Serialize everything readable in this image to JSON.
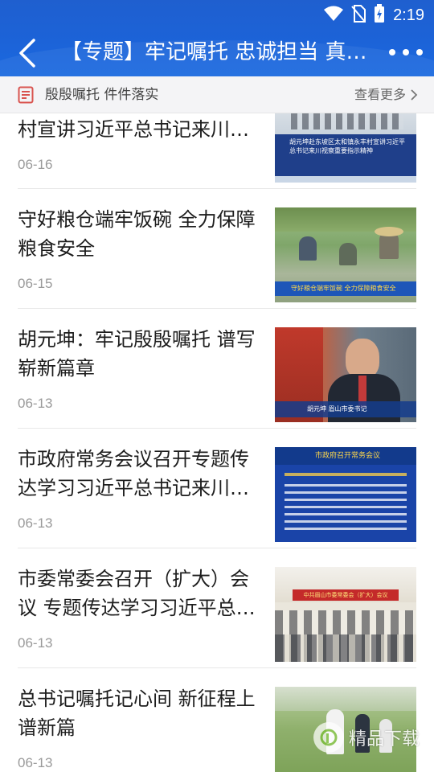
{
  "status_bar": {
    "time": "2:19"
  },
  "header": {
    "title": "【专题】牢记嘱托 忠诚担当 真抓实干"
  },
  "subheader": {
    "title": "殷殷嘱托 件件落实",
    "see_more": "查看更多"
  },
  "articles": [
    {
      "title": "村宣讲习近平总书记来川视察重要指示精神",
      "date": "06-16",
      "thumb_caption": "胡元坤赴东坡区太和镇永丰村宣讲习近平总书记来川视察重要指示精神"
    },
    {
      "title": "守好粮仓端牢饭碗 全力保障粮食安全",
      "date": "06-15",
      "thumb_caption": "守好粮仓端牢饭碗 全力保障粮食安全"
    },
    {
      "title": "胡元坤：牢记殷殷嘱托 谱写崭新篇章",
      "date": "06-13",
      "thumb_caption": "胡元坤 眉山市委书记"
    },
    {
      "title": "市政府常务会议召开专题传达学习习近平总书记来川视察重要指示精神",
      "date": "06-13",
      "thumb_caption": "市政府召开常务会议"
    },
    {
      "title": "市委常委会召开（扩大）会议 专题传达学习习近平总书记来川视察重要指示精神",
      "date": "06-13",
      "thumb_caption": "中共眉山市委常委会（扩大）会议"
    },
    {
      "title": "总书记嘱托记心间 新征程上谱新篇",
      "date": "06-13",
      "thumb_caption": ""
    }
  ],
  "watermark": {
    "text": "精品下载"
  }
}
